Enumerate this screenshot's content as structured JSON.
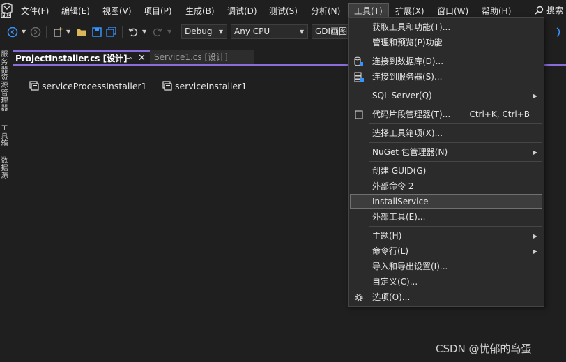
{
  "menubar": {
    "logo_text": "PRE",
    "items": [
      "文件(F)",
      "编辑(E)",
      "视图(V)",
      "项目(P)",
      "生成(B)",
      "调试(D)",
      "测试(S)",
      "分析(N)",
      "工具(T)",
      "扩展(X)",
      "窗口(W)",
      "帮助(H)"
    ],
    "search_label": "搜索"
  },
  "toolbar": {
    "configuration": "Debug",
    "platform": "Any CPU",
    "target": "GDI画图"
  },
  "left_strip": [
    "服务器资源管理器",
    "工具箱",
    "数据源"
  ],
  "tabs": [
    {
      "label": "ProjectInstaller.cs [设计]",
      "active": true
    },
    {
      "label": "Service1.cs [设计]",
      "active": false
    }
  ],
  "designer": {
    "components": [
      "serviceProcessInstaller1",
      "serviceInstaller1"
    ]
  },
  "tools_menu": {
    "items": [
      {
        "label": "获取工具和功能(T)..."
      },
      {
        "label": "管理和预览(P)功能"
      },
      {
        "label": "连接到数据库(D)...",
        "icon": "database-connect-icon"
      },
      {
        "label": "连接到服务器(S)...",
        "icon": "server-connect-icon"
      },
      {
        "label": "SQL Server(Q)",
        "submenu": true
      },
      {
        "label": "代码片段管理器(T)...",
        "shortcut": "Ctrl+K, Ctrl+B",
        "icon": "snippet-icon"
      },
      {
        "label": "选择工具箱项(X)..."
      },
      {
        "label": "NuGet 包管理器(N)",
        "submenu": true
      },
      {
        "label": "创建 GUID(G)"
      },
      {
        "label": "外部命令 2"
      },
      {
        "label": "InstallService",
        "highlighted": true
      },
      {
        "label": "外部工具(E)..."
      },
      {
        "label": "主题(H)",
        "submenu": true
      },
      {
        "label": "命令行(L)",
        "submenu": true
      },
      {
        "label": "导入和导出设置(I)..."
      },
      {
        "label": "自定义(C)..."
      },
      {
        "label": "选项(O)...",
        "icon": "gear-icon"
      }
    ]
  },
  "watermark": "CSDN @忧郁的鸟蛋",
  "colors": {
    "background": "#1f1f1f",
    "accent": "#8a6cdb",
    "menu_bg": "#2b2b2b",
    "icon_blue": "#3794ff"
  }
}
